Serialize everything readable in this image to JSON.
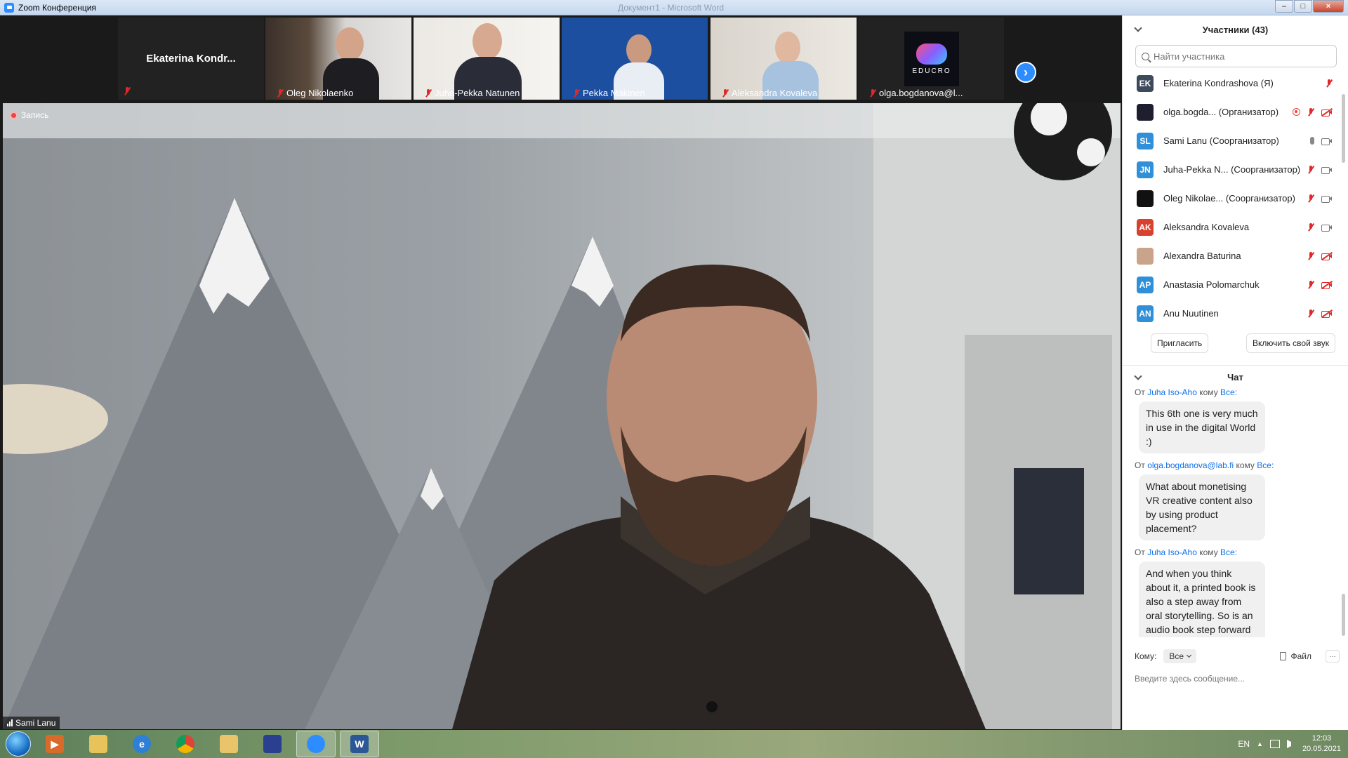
{
  "window": {
    "title": "Zoom Конференция",
    "center_title": "Документ1 - Microsoft Word",
    "controls": [
      "–",
      "□",
      "×"
    ]
  },
  "strip": {
    "thumbnails": [
      {
        "name": "Ekaterina  Kondr...",
        "muted": true,
        "video": false
      },
      {
        "name": "Oleg Nikolaenko",
        "muted": true,
        "video": true
      },
      {
        "name": "Juha-Pekka Natunen",
        "muted": true,
        "video": true
      },
      {
        "name": "Pekka Mäkinen",
        "muted": true,
        "video": true
      },
      {
        "name": "Aleksandra Kovaleva",
        "muted": true,
        "video": true
      },
      {
        "name": "olga.bogdanova@l...",
        "muted": true,
        "video": false,
        "logo": "EDUCRO"
      }
    ],
    "next_icon": "›"
  },
  "main": {
    "recording_label": "Запись",
    "speaker_name": "Sami Lanu"
  },
  "participants": {
    "header": "Участники (43)",
    "search_placeholder": "Найти участника",
    "list": [
      {
        "initials": "EK",
        "color": "#3d4a5c",
        "name": "Ekaterina Kondrashova (Я)",
        "mic": "muted",
        "cam": "none"
      },
      {
        "initials": "",
        "color": "#1e1e2e",
        "name": "olga.bogda...  (Организатор)",
        "mic": "muted",
        "cam": "off",
        "recording": true
      },
      {
        "initials": "SL",
        "color": "#2f8fd8",
        "name": "Sami Lanu (Соорганизатор)",
        "mic": "on",
        "cam": "on"
      },
      {
        "initials": "JN",
        "color": "#2f8fd8",
        "name": "Juha-Pekka N...  (Соорганизатор)",
        "mic": "muted",
        "cam": "on"
      },
      {
        "initials": "",
        "color": "#111111",
        "name": "Oleg Nikolae...  (Соорганизатор)",
        "mic": "muted",
        "cam": "on"
      },
      {
        "initials": "AK",
        "color": "#d9412f",
        "name": "Aleksandra Kovaleva",
        "mic": "muted",
        "cam": "on"
      },
      {
        "initials": "",
        "color": "#c9a38a",
        "name": "Alexandra Baturina",
        "mic": "muted",
        "cam": "off"
      },
      {
        "initials": "AP",
        "color": "#2f8fd8",
        "name": "Anastasia Polomarchuk",
        "mic": "muted",
        "cam": "off"
      },
      {
        "initials": "AN",
        "color": "#2f8fd8",
        "name": "Anu Nuutinen",
        "mic": "muted",
        "cam": "off"
      }
    ],
    "invite_button": "Пригласить",
    "unmute_button": "Включить свой звук"
  },
  "chat": {
    "header": "Чат",
    "messages": [
      {
        "prefix": "От",
        "from": "Juha Iso-Aho",
        "mid": "кому",
        "to": "Все:",
        "text": "This 6th one is very much in use in the digital World :)"
      },
      {
        "prefix": "От",
        "from": "olga.bogdanova@lab.fi",
        "mid": "кому",
        "to": "Все:",
        "text": "What about monetising VR creative content also by using product placement?"
      },
      {
        "prefix": "От",
        "from": "Juha Iso-Aho",
        "mid": "кому",
        "to": "Все:",
        "text": "And when you think about it, a printed book is also a step away from oral storytelling. So is an audio book step forward or a step back?"
      }
    ],
    "to_label": "Кому:",
    "to_value": "Все",
    "file_label": "Файл",
    "more_label": "···",
    "input_placeholder": "Введите здесь сообщение..."
  },
  "taskbar": {
    "lang": "EN",
    "time": "12:03",
    "date": "20.05.2021",
    "apps": [
      "media-player-icon",
      "explorer-icon",
      "ie-icon",
      "chrome-icon",
      "folder-icon",
      "save-icon",
      "zoom-icon",
      "word-icon"
    ]
  }
}
